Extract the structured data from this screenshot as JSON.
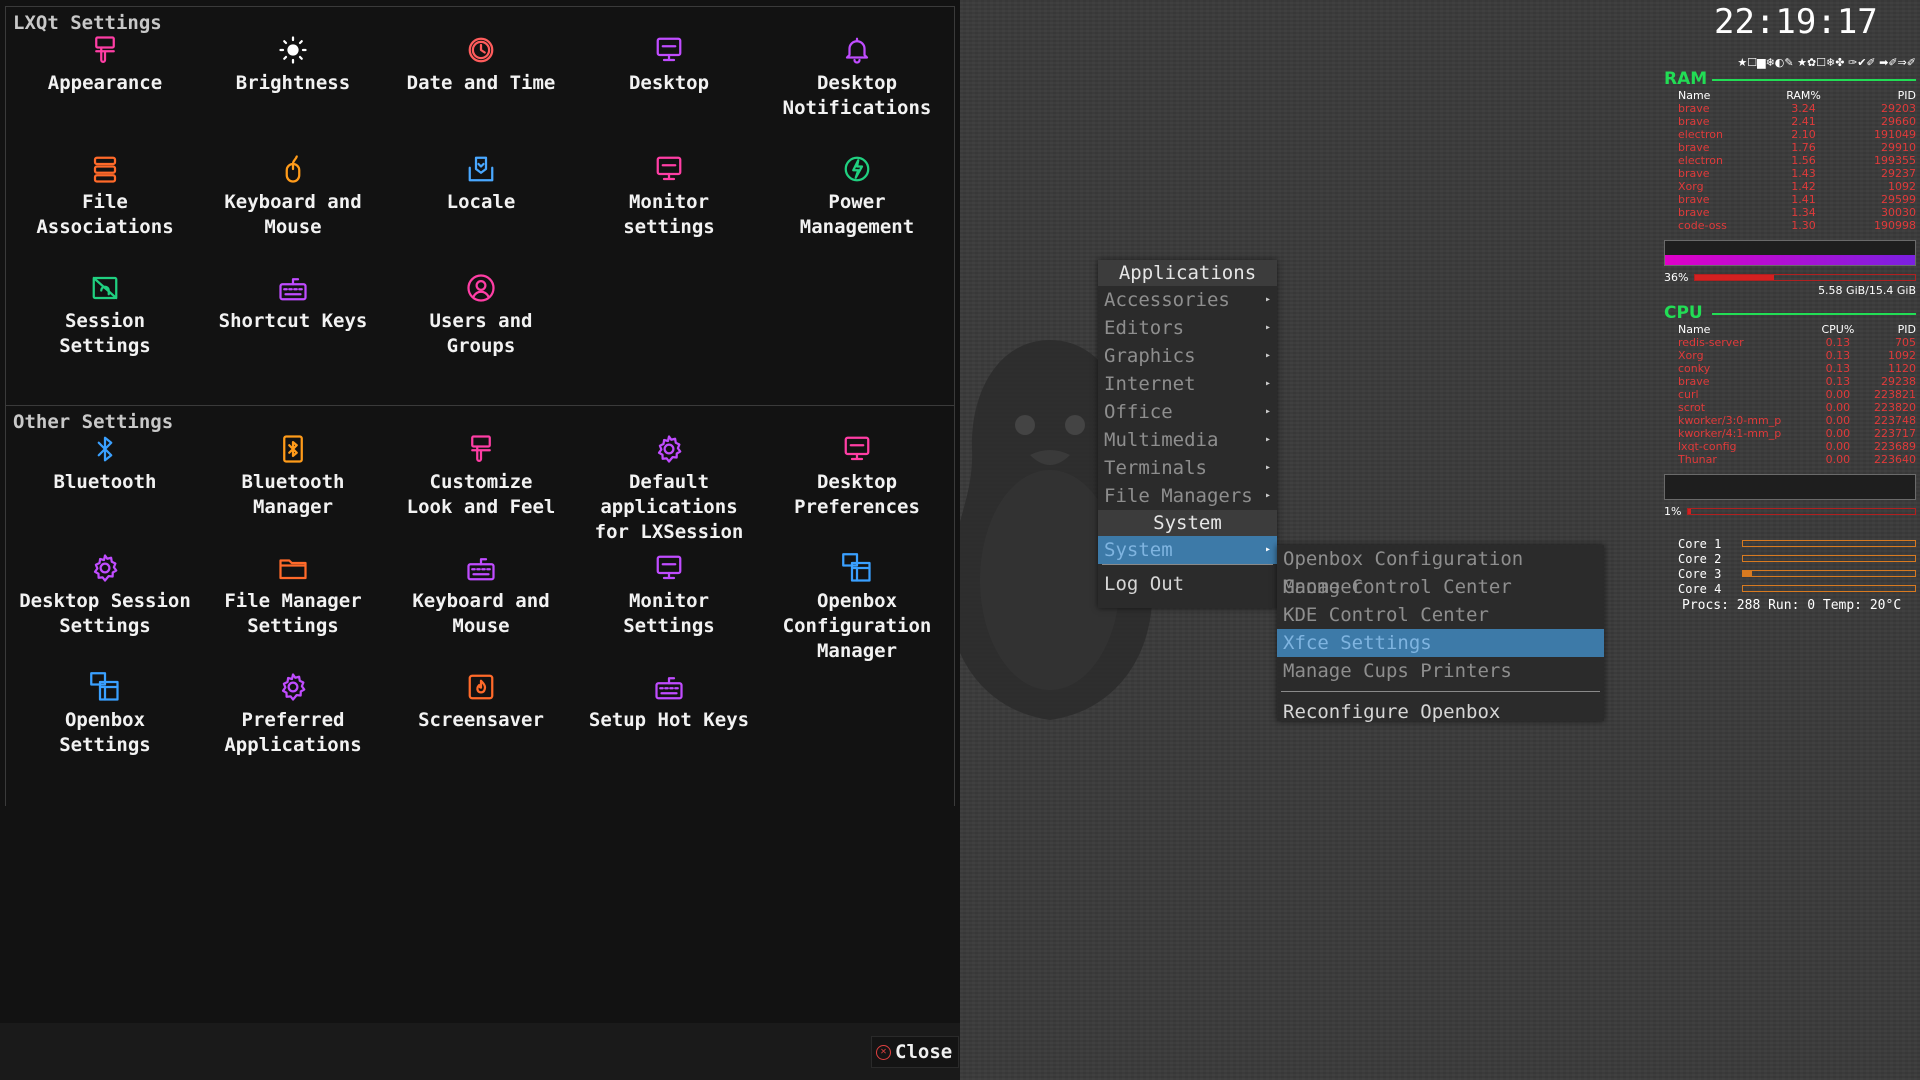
{
  "settings": {
    "group1": {
      "title": "LXQt Settings",
      "items": [
        {
          "label": "Appearance",
          "icon": "paint-brush-icon",
          "color": "#ff3ea5"
        },
        {
          "label": "Brightness",
          "icon": "brightness-icon",
          "color": "#ffffff"
        },
        {
          "label": "Date and Time",
          "icon": "clock-icon",
          "color": "#ff5c5c"
        },
        {
          "label": "Desktop",
          "icon": "monitor-icon",
          "color": "#c04cff"
        },
        {
          "label": "Desktop\nNotifications",
          "icon": "bell-icon",
          "color": "#c04cff"
        },
        {
          "label": "File\nAssociations",
          "icon": "stack-icon",
          "color": "#ff6a2a"
        },
        {
          "label": "Keyboard and\nMouse",
          "icon": "mouse-icon",
          "color": "#ff9b1a"
        },
        {
          "label": "Locale",
          "icon": "locale-icon",
          "color": "#4aa8ff"
        },
        {
          "label": "Monitor\nsettings",
          "icon": "monitor-icon",
          "color": "#ff3ea5"
        },
        {
          "label": "Power\nManagement",
          "icon": "power-icon",
          "color": "#20d080"
        },
        {
          "label": "Session\nSettings",
          "icon": "session-icon",
          "color": "#20d080"
        },
        {
          "label": "Shortcut Keys",
          "icon": "keyboard-icon",
          "color": "#c04cff"
        },
        {
          "label": "Users and\nGroups",
          "icon": "user-icon",
          "color": "#ff3ea5"
        }
      ]
    },
    "group2": {
      "title": "Other Settings",
      "items": [
        {
          "label": "Bluetooth",
          "icon": "bluetooth-icon",
          "color": "#3aa0ff"
        },
        {
          "label": "Bluetooth\nManager",
          "icon": "bluetooth-box-icon",
          "color": "#ff9b1a"
        },
        {
          "label": "Customize\nLook and Feel",
          "icon": "paint-brush-icon",
          "color": "#ff3ea5"
        },
        {
          "label": "Default\napplications\nfor LXSession",
          "icon": "gear-icon",
          "color": "#c04cff"
        },
        {
          "label": "Desktop\nPreferences",
          "icon": "monitor-icon",
          "color": "#ff3ea5"
        },
        {
          "label": "Desktop Session\nSettings",
          "icon": "gear-icon",
          "color": "#c04cff"
        },
        {
          "label": "File Manager\nSettings",
          "icon": "folder-icon",
          "color": "#ff6a2a"
        },
        {
          "label": "Keyboard and\nMouse",
          "icon": "keyboard-icon",
          "color": "#c04cff"
        },
        {
          "label": "Monitor\nSettings",
          "icon": "monitor-icon",
          "color": "#c04cff"
        },
        {
          "label": "Openbox\nConfiguration\nManager",
          "icon": "openbox-icon",
          "color": "#3aa0ff"
        },
        {
          "label": "Openbox\nSettings",
          "icon": "openbox-icon",
          "color": "#3aa0ff"
        },
        {
          "label": "Preferred\nApplications",
          "icon": "gear-icon",
          "color": "#c04cff"
        },
        {
          "label": "Screensaver",
          "icon": "flame-icon",
          "color": "#ff6a2a"
        },
        {
          "label": "Setup Hot Keys",
          "icon": "keyboard-icon",
          "color": "#c04cff"
        }
      ]
    },
    "close_label": "Close"
  },
  "app_menu": {
    "title": "Applications",
    "items": [
      "Accessories",
      "Editors",
      "Graphics",
      "Internet",
      "Office",
      "Multimedia",
      "Terminals",
      "File Managers"
    ],
    "system_header": "System",
    "system_item": "System",
    "logout": "Log Out"
  },
  "system_menu": {
    "items": [
      "Openbox Configuration Manager",
      "Gnome Control Center",
      "KDE Control Center",
      "Xfce Settings",
      "Manage Cups Printers"
    ],
    "reconfigure": "Reconfigure Openbox"
  },
  "clock": "22:19:17",
  "conky": {
    "icon_strip": "★☐▆❄◐✎ ★✿☐❄✤ ✑✔✐ ➡✐⇒✐",
    "ram": {
      "title": "RAM",
      "headers": [
        "Name",
        "RAM%",
        "PID"
      ],
      "rows": [
        [
          "brave",
          "3.24",
          "29203"
        ],
        [
          "brave",
          "2.41",
          "29660"
        ],
        [
          "electron",
          "2.10",
          "191049"
        ],
        [
          "brave",
          "1.76",
          "29910"
        ],
        [
          "electron",
          "1.56",
          "199355"
        ],
        [
          "brave",
          "1.43",
          "29237"
        ],
        [
          "Xorg",
          "1.42",
          "1092"
        ],
        [
          "brave",
          "1.41",
          "29599"
        ],
        [
          "brave",
          "1.34",
          "30030"
        ],
        [
          "code-oss",
          "1.30",
          "190998"
        ]
      ],
      "percent_label": "36%",
      "percent": 0.36,
      "usage": "5.58 GiB/15.4 GiB"
    },
    "cpu": {
      "title": "CPU",
      "headers": [
        "Name",
        "CPU%",
        "PID"
      ],
      "rows": [
        [
          "redis-server",
          "0.13",
          "705"
        ],
        [
          "Xorg",
          "0.13",
          "1092"
        ],
        [
          "conky",
          "0.13",
          "1120"
        ],
        [
          "brave",
          "0.13",
          "29238"
        ],
        [
          "curl",
          "0.00",
          "223821"
        ],
        [
          "scrot",
          "0.00",
          "223820"
        ],
        [
          "kworker/3:0-mm_p",
          "0.00",
          "223748"
        ],
        [
          "kworker/4:1-mm_p",
          "0.00",
          "223717"
        ],
        [
          "lxqt-config",
          "0.00",
          "223689"
        ],
        [
          "Thunar",
          "0.00",
          "223640"
        ]
      ],
      "percent_label": "1%",
      "percent": 0.01,
      "cores": [
        {
          "label": "Core 1",
          "value": 0.0
        },
        {
          "label": "Core 2",
          "value": 0.0
        },
        {
          "label": "Core 3",
          "value": 0.05
        },
        {
          "label": "Core 4",
          "value": 0.0
        }
      ],
      "procs": "Procs: 288  Run: 0 Temp: 20°C"
    },
    "colors": {
      "header_green": "#22dd55",
      "proc_red": "#e03a3a",
      "ram_bar": "#d400d4",
      "core_orange": "#d87a20"
    }
  }
}
